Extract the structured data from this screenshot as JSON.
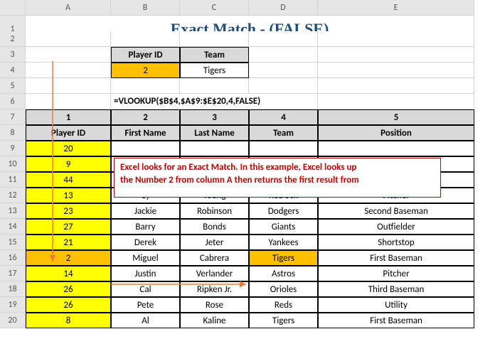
{
  "cols": [
    "A",
    "B",
    "C",
    "D",
    "E"
  ],
  "rows": [
    "1",
    "2",
    "3",
    "4",
    "5",
    "6",
    "7",
    "8",
    "9",
    "10",
    "11",
    "12",
    "13",
    "14",
    "15",
    "16",
    "17",
    "18",
    "19",
    "20"
  ],
  "title": "Exact Match - (FALSE)",
  "lookup": {
    "headers": {
      "id": "Player ID",
      "team": "Team"
    },
    "value_id": "2",
    "value_team": "Tigers"
  },
  "formula": "=VLOOKUP($B$4,$A$9:$E$20,4,FALSE)",
  "col_index": {
    "c1": "1",
    "c2": "2",
    "c3": "3",
    "c4": "4",
    "c5": "5"
  },
  "table_headers": {
    "id": "Player ID",
    "first": "First Name",
    "last": "Last Name",
    "team": "Team",
    "pos": "Position"
  },
  "players": [
    {
      "id": "20",
      "first": "",
      "last": "",
      "team": "",
      "pos": ""
    },
    {
      "id": "9",
      "first": "",
      "last": "",
      "team": "",
      "pos": ""
    },
    {
      "id": "44",
      "first": "",
      "last": "",
      "team": "",
      "pos": ""
    },
    {
      "id": "13",
      "first": "Cy",
      "last": "Young",
      "team": "Red Sox",
      "pos": "Pitcher"
    },
    {
      "id": "23",
      "first": "Jackie",
      "last": "Robinson",
      "team": "Dodgers",
      "pos": "Second Baseman"
    },
    {
      "id": "27",
      "first": "Barry",
      "last": "Bonds",
      "team": "Giants",
      "pos": "Outfielder"
    },
    {
      "id": "21",
      "first": "Derek",
      "last": "Jeter",
      "team": "Yankees",
      "pos": "Shortstop"
    },
    {
      "id": "2",
      "first": "Miguel",
      "last": "Cabrera",
      "team": "Tigers",
      "pos": "First Baseman"
    },
    {
      "id": "14",
      "first": "Justin",
      "last": "Verlander",
      "team": "Astros",
      "pos": "Pitcher"
    },
    {
      "id": "26",
      "first": "Cal",
      "last": "Ripken Jr.",
      "team": "Orioles",
      "pos": "Third Baseman"
    },
    {
      "id": "26",
      "first": "Pete",
      "last": "Rose",
      "team": "Reds",
      "pos": "Utility"
    },
    {
      "id": "8",
      "first": "Al",
      "last": "Kaline",
      "team": "Tigers",
      "pos": "First Baseman"
    }
  ],
  "callout_line1": "Excel looks for an Exact Match. In this example, Excel looks up",
  "callout_line2": "the Number 2 from column A then returns the first result from",
  "chart_data": {
    "type": "table",
    "title": "Exact Match - (FALSE)",
    "columns": [
      "Player ID",
      "First Name",
      "Last Name",
      "Team",
      "Position"
    ],
    "rows": [
      [
        20,
        "",
        "",
        "",
        ""
      ],
      [
        9,
        "",
        "",
        "",
        ""
      ],
      [
        44,
        "",
        "",
        "",
        ""
      ],
      [
        13,
        "Cy",
        "Young",
        "Red Sox",
        "Pitcher"
      ],
      [
        23,
        "Jackie",
        "Robinson",
        "Dodgers",
        "Second Baseman"
      ],
      [
        27,
        "Barry",
        "Bonds",
        "Giants",
        "Outfielder"
      ],
      [
        21,
        "Derek",
        "Jeter",
        "Yankees",
        "Shortstop"
      ],
      [
        2,
        "Miguel",
        "Cabrera",
        "Tigers",
        "First Baseman"
      ],
      [
        14,
        "Justin",
        "Verlander",
        "Astros",
        "Pitcher"
      ],
      [
        26,
        "Cal",
        "Ripken Jr.",
        "Orioles",
        "Third Baseman"
      ],
      [
        26,
        "Pete",
        "Rose",
        "Reds",
        "Utility"
      ],
      [
        8,
        "Al",
        "Kaline",
        "Tigers",
        "First Baseman"
      ]
    ],
    "lookup_value": 2,
    "result_column_index": 4,
    "result_value": "Tigers",
    "formula": "=VLOOKUP($B$4,$A$9:$E$20,4,FALSE)"
  }
}
